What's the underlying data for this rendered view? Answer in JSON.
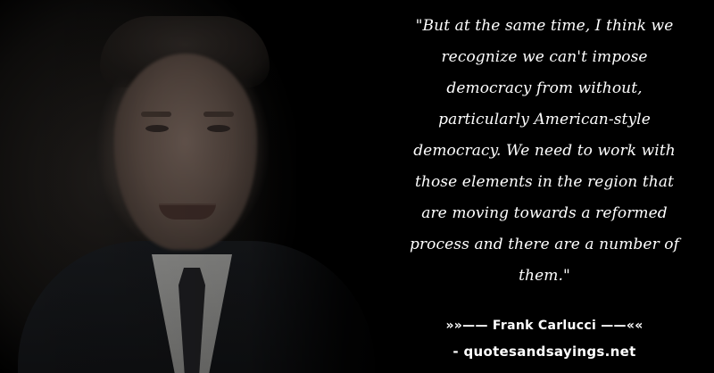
{
  "quote": {
    "text": "\"But at the same time, I think we recognize we can't impose democracy from without, particularly American-style democracy. We need to work with those elements in the region that are moving towards a reformed process and there are a number of them.\"",
    "lines": [
      "\"But at the same time, I think we",
      "recognize we can't impose",
      "democracy from without,",
      "particularly American-style",
      "democracy. We need to work with",
      "those elements in the region that",
      "are moving towards a reformed",
      "process and there are a number of",
      "them.\""
    ]
  },
  "author": "»»—— Frank Carlucci ——««",
  "source": "- quotesandsayings.net"
}
